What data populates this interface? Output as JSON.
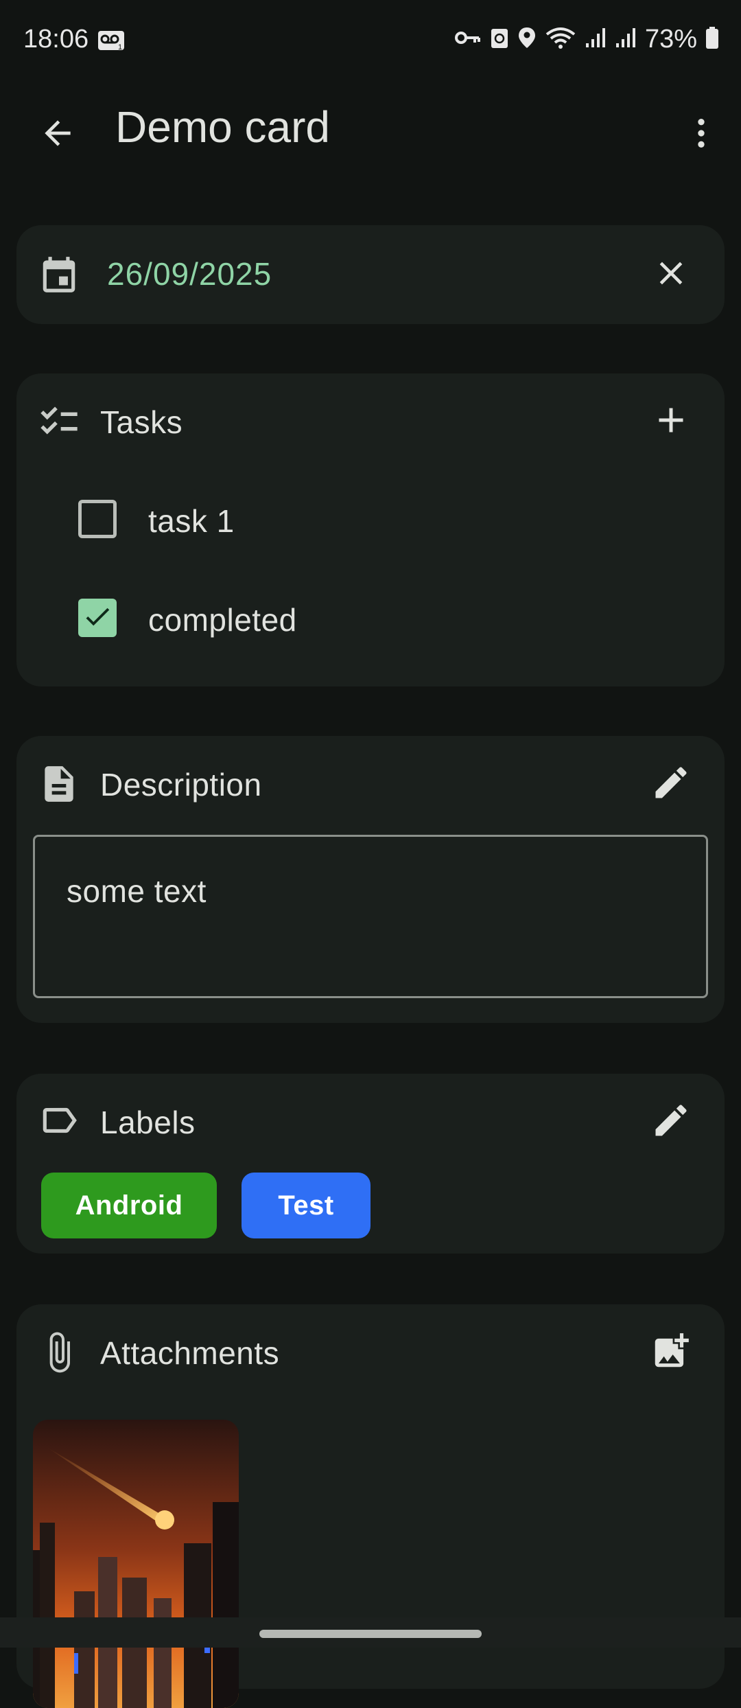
{
  "status_bar": {
    "time": "18:06",
    "battery_percent": "73%",
    "icons": [
      "voicemail-icon",
      "vpn-key-icon",
      "recycle-icon",
      "location-icon",
      "wifi-icon",
      "signal-icon",
      "signal-icon",
      "battery-icon"
    ]
  },
  "app_bar": {
    "title": "Demo card",
    "back_icon": "arrow-back-icon",
    "menu_icon": "more-vert-icon"
  },
  "due_date": {
    "value": "26/09/2025",
    "icon": "calendar-icon",
    "clear_icon": "close-icon"
  },
  "tasks": {
    "title": "Tasks",
    "icon": "checklist-icon",
    "add_icon": "add-icon",
    "items": [
      {
        "label": "task 1",
        "checked": false
      },
      {
        "label": "completed",
        "checked": true
      }
    ]
  },
  "description": {
    "title": "Description",
    "icon": "document-icon",
    "edit_icon": "edit-icon",
    "text": "some text"
  },
  "labels": {
    "title": "Labels",
    "icon": "label-icon",
    "edit_icon": "edit-icon",
    "chips": [
      {
        "label": "Android",
        "color": "#2e9a1e"
      },
      {
        "label": "Test",
        "color": "#2f6ff5"
      }
    ]
  },
  "attachments": {
    "title": "Attachments",
    "icon": "paperclip-icon",
    "add_icon": "add-photo-icon"
  },
  "colors": {
    "background": "#111412",
    "card": "#1a1f1c",
    "accent": "#8fd4a6"
  }
}
